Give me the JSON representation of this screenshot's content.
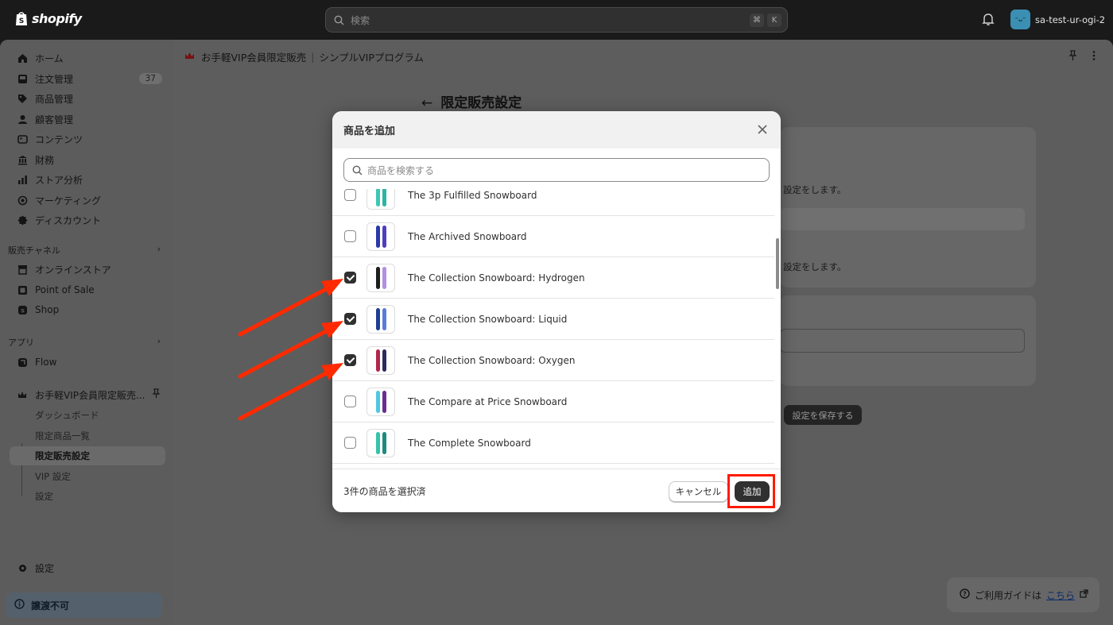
{
  "topbar": {
    "brand": "shopify",
    "search_placeholder": "検索",
    "kbd": [
      "⌘",
      "K"
    ],
    "store_name": "sa-test-ur-ogi-2",
    "store_initials": "ᵔᴗᵔ"
  },
  "sidebar": {
    "items": [
      {
        "label": "ホーム",
        "icon": "home-icon"
      },
      {
        "label": "注文管理",
        "icon": "inbox-icon",
        "count": "37"
      },
      {
        "label": "商品管理",
        "icon": "tag-icon"
      },
      {
        "label": "顧客管理",
        "icon": "person-icon"
      },
      {
        "label": "コンテンツ",
        "icon": "content-icon"
      },
      {
        "label": "財務",
        "icon": "bank-icon"
      },
      {
        "label": "ストア分析",
        "icon": "chart-icon"
      },
      {
        "label": "マーケティング",
        "icon": "target-icon"
      },
      {
        "label": "ディスカウント",
        "icon": "discount-icon"
      }
    ],
    "sales_channels_heading": "販売チャネル",
    "channels": [
      {
        "label": "オンラインストア",
        "icon": "store-icon"
      },
      {
        "label": "Point of Sale",
        "icon": "pos-icon"
      },
      {
        "label": "Shop",
        "icon": "shop-icon"
      }
    ],
    "apps_heading": "アプリ",
    "apps": [
      {
        "label": "Flow",
        "icon": "flow-icon"
      }
    ],
    "pinned_app": "お手軽VIP会員限定販売...",
    "sub_items": [
      "ダッシュボード",
      "限定商品一覧",
      "限定販売設定",
      "VIP 設定",
      "設定"
    ],
    "settings_label": "設定",
    "transfer_label": "譲渡不可"
  },
  "main": {
    "breadcrumb_app": "お手軽VIP会員限定販売",
    "breadcrumb_sep": "|",
    "breadcrumb_page": "シンプルVIPプログラム",
    "page_title": "限定販売設定",
    "card_text_1": "設定をします。",
    "card_text_2": "設定をします。",
    "save_button": "設定を保存する",
    "guide_text": "ご利用ガイドは",
    "guide_link": "こちら"
  },
  "modal": {
    "title": "商品を追加",
    "search_placeholder": "商品を検索する",
    "products": [
      {
        "name": "The 3p Fulfilled Snowboard",
        "checked": false,
        "colors": [
          "#3fc6b3",
          "#2bb5a3"
        ]
      },
      {
        "name": "The Archived Snowboard",
        "checked": false,
        "colors": [
          "#2a3aa8",
          "#4f3fbf"
        ]
      },
      {
        "name": "The Collection Snowboard: Hydrogen",
        "checked": true,
        "colors": [
          "#1d1d1d",
          "#b28fe0"
        ]
      },
      {
        "name": "The Collection Snowboard: Liquid",
        "checked": true,
        "colors": [
          "#1f3f8f",
          "#5a7bd8"
        ]
      },
      {
        "name": "The Collection Snowboard: Oxygen",
        "checked": true,
        "colors": [
          "#b0264f",
          "#2b2b5e"
        ]
      },
      {
        "name": "The Compare at Price Snowboard",
        "checked": false,
        "colors": [
          "#4ec8e0",
          "#6a2c8f"
        ]
      },
      {
        "name": "The Complete Snowboard",
        "checked": false,
        "colors": [
          "#35c3a8",
          "#1e8a7e"
        ]
      }
    ],
    "selected_count_text": "3件の商品を選択済",
    "cancel_label": "キャンセル",
    "add_label": "追加"
  },
  "colors": {
    "annotation_red": "#ff1a00",
    "primary_button": "#303030"
  }
}
